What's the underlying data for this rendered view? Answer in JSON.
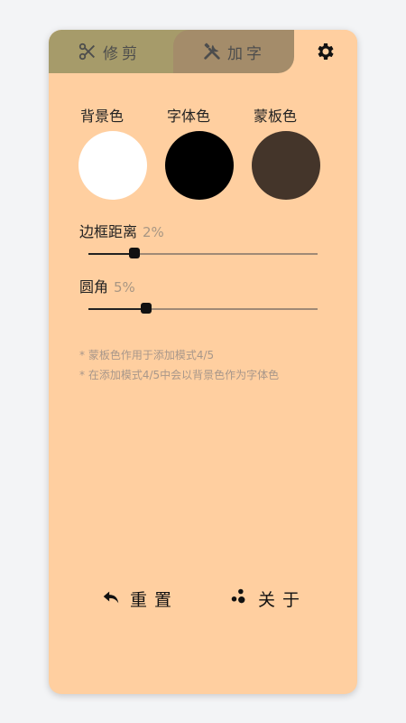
{
  "tabs": {
    "trim_label": "修剪",
    "addtext_label": "加字"
  },
  "colors": {
    "background": {
      "label": "背景色",
      "value": "#ffffff"
    },
    "font": {
      "label": "字体色",
      "value": "#000000"
    },
    "mask": {
      "label": "蒙板色",
      "value": "#44352a"
    }
  },
  "sliders": {
    "border": {
      "label": "边框距离",
      "value_text": "2%",
      "value": 0.2
    },
    "radius": {
      "label": "圆角",
      "value_text": "5%",
      "value": 0.25
    }
  },
  "notes": [
    "* 蒙板色作用于添加模式4/5",
    "* 在添加模式4/5中会以背景色作为字体色"
  ],
  "actions": {
    "reset_label": "重置",
    "about_label": "关于"
  },
  "theme": {
    "panel": "#ffcfa0",
    "tab_trim": "#a69b6a",
    "tab_addtext": "#a48c6a"
  }
}
